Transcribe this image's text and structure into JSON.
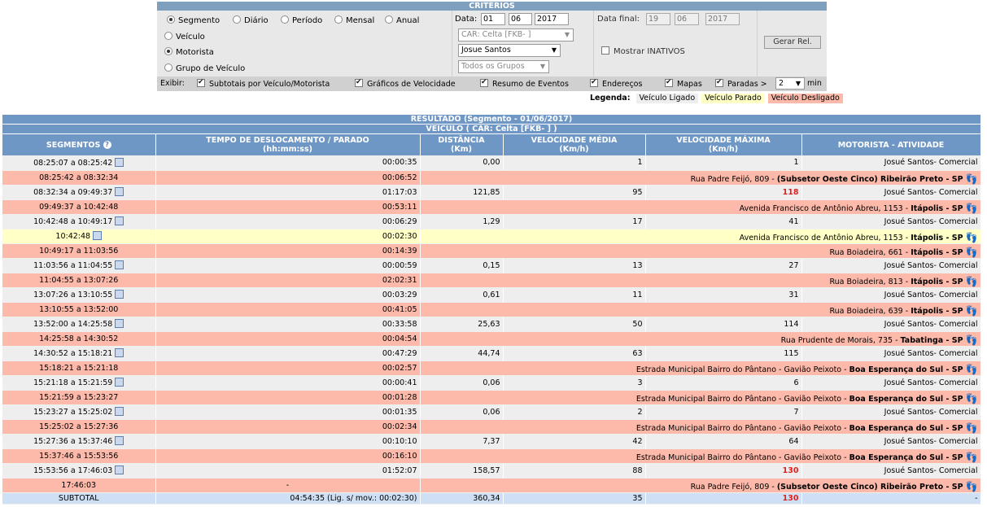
{
  "criteria": {
    "title": "CRITÉRIOS",
    "modes": [
      "Segmento",
      "Diário",
      "Período",
      "Mensal",
      "Anual"
    ],
    "entity_options": [
      "Veículo",
      "Motorista",
      "Grupo de Veículo"
    ],
    "date_label": "Data:",
    "date": {
      "d": "01",
      "m": "06",
      "y": "2017"
    },
    "final_label": "Data final:",
    "final_date": {
      "d": "19",
      "m": "06",
      "y": "2017"
    },
    "vehicle_select": "CAR: Celta [FKB-      ]",
    "driver_select": "Josue Santos",
    "group_select": "Todos os Grupos",
    "show_inactive": "Mostrar INATIVOS",
    "generate_button": "Gerar Rel.",
    "exibir_label": "Exibir:",
    "options": [
      "Subtotais por Veículo/Motorista",
      "Gráficos de Velocidade",
      "Resumo de Eventos",
      "Endereços",
      "Mapas",
      "Paradas >"
    ],
    "paradas_value": "2",
    "min_label": "min"
  },
  "legend": {
    "label": "Legenda:",
    "on": "Veículo Ligado",
    "parked": "Veículo Parado",
    "off": "Veículo Desligado"
  },
  "result": {
    "title": "RESULTADO (Segmento - 01/06/2017)",
    "vehicle": "VEÍCULO ( CAR: Celta [FKB-        ] )",
    "headers": {
      "seg": "SEGMENTOS",
      "time": "TEMPO DE DESLOCAMENTO / PARADO",
      "time_unit": "(hh:mm:ss)",
      "dist": "DISTÂNCIA",
      "dist_unit": "(Km)",
      "avg": "VELOCIDADE MÉDIA",
      "avg_unit": "(Km/h)",
      "max": "VELOCIDADE MÁXIMA",
      "max_unit": "(Km/h)",
      "driver": "MOTORISTA - ATIVIDADE"
    },
    "rows": [
      {
        "t": "on",
        "seg": "08:25:07 a 08:25:42",
        "time": "00:00:35",
        "dist": "0,00",
        "avg": "1",
        "max": "1",
        "drv": "Josué Santos",
        "act": "Comercial"
      },
      {
        "t": "off",
        "seg": "08:25:42 a 08:32:34",
        "time": "00:06:52",
        "addr": "Rua Padre Feijó, 809 - ",
        "city": "(Subsetor Oeste Cinco) Ribeirão Preto - SP"
      },
      {
        "t": "on",
        "seg": "08:32:34 a 09:49:37",
        "time": "01:17:03",
        "dist": "121,85",
        "avg": "95",
        "max": "118",
        "hot": true,
        "drv": "Josué Santos",
        "act": "Comercial"
      },
      {
        "t": "off",
        "seg": "09:49:37 a 10:42:48",
        "time": "00:53:11",
        "addr": "Avenida Francisco de Antônio Abreu, 1153 - ",
        "city": "Itápolis - SP"
      },
      {
        "t": "on",
        "seg": "10:42:48 a 10:49:17",
        "time": "00:06:29",
        "dist": "1,29",
        "avg": "17",
        "max": "41",
        "drv": "Josué Santos",
        "act": "Comercial"
      },
      {
        "t": "park",
        "seg": "10:42:48",
        "time": "00:02:30",
        "addr": "Avenida Francisco de Antônio Abreu, 1153 - ",
        "city": "Itápolis - SP"
      },
      {
        "t": "off",
        "seg": "10:49:17 a 11:03:56",
        "time": "00:14:39",
        "addr": "Rua Boiadeira, 661 - ",
        "city": "Itápolis - SP"
      },
      {
        "t": "on",
        "seg": "11:03:56 a 11:04:55",
        "time": "00:00:59",
        "dist": "0,15",
        "avg": "13",
        "max": "27",
        "drv": "Josué Santos",
        "act": "Comercial"
      },
      {
        "t": "off",
        "seg": "11:04:55 a 13:07:26",
        "time": "02:02:31",
        "addr": "Rua Boiadeira, 813 - ",
        "city": "Itápolis - SP"
      },
      {
        "t": "on",
        "seg": "13:07:26 a 13:10:55",
        "time": "00:03:29",
        "dist": "0,61",
        "avg": "11",
        "max": "31",
        "drv": "Josué Santos",
        "act": "Comercial"
      },
      {
        "t": "off",
        "seg": "13:10:55 a 13:52:00",
        "time": "00:41:05",
        "addr": "Rua Boiadeira, 639 - ",
        "city": "Itápolis - SP"
      },
      {
        "t": "on",
        "seg": "13:52:00 a 14:25:58",
        "time": "00:33:58",
        "dist": "25,63",
        "avg": "50",
        "max": "114",
        "drv": "Josué Santos",
        "act": "Comercial"
      },
      {
        "t": "off",
        "seg": "14:25:58 a 14:30:52",
        "time": "00:04:54",
        "addr": "Rua Prudente de Morais, 735 - ",
        "city": "Tabatinga - SP"
      },
      {
        "t": "on",
        "seg": "14:30:52 a 15:18:21",
        "time": "00:47:29",
        "dist": "44,74",
        "avg": "63",
        "max": "115",
        "drv": "Josué Santos",
        "act": "Comercial"
      },
      {
        "t": "off",
        "seg": "15:18:21 a 15:21:18",
        "time": "00:02:57",
        "addr": "Estrada Municipal Bairro do Pântano - Gavião Peixoto - ",
        "city": "Boa Esperança do Sul - SP"
      },
      {
        "t": "on",
        "seg": "15:21:18 a 15:21:59",
        "time": "00:00:41",
        "dist": "0,06",
        "avg": "3",
        "max": "6",
        "drv": "Josué Santos",
        "act": "Comercial"
      },
      {
        "t": "off",
        "seg": "15:21:59 a 15:23:27",
        "time": "00:01:28",
        "addr": "Estrada Municipal Bairro do Pântano - Gavião Peixoto - ",
        "city": "Boa Esperança do Sul - SP"
      },
      {
        "t": "on",
        "seg": "15:23:27 a 15:25:02",
        "time": "00:01:35",
        "dist": "0,06",
        "avg": "2",
        "max": "7",
        "drv": "Josué Santos",
        "act": "Comercial"
      },
      {
        "t": "off",
        "seg": "15:25:02 a 15:27:36",
        "time": "00:02:34",
        "addr": "Estrada Municipal Bairro do Pântano - Gavião Peixoto - ",
        "city": "Boa Esperança do Sul - SP"
      },
      {
        "t": "on",
        "seg": "15:27:36 a 15:37:46",
        "time": "00:10:10",
        "dist": "7,37",
        "avg": "42",
        "max": "64",
        "drv": "Josué Santos",
        "act": "Comercial"
      },
      {
        "t": "off",
        "seg": "15:37:46 a 15:53:56",
        "time": "00:16:10",
        "addr": "Estrada Municipal Bairro do Pântano - Gavião Peixoto - ",
        "city": "Boa Esperança do Sul - SP"
      },
      {
        "t": "on",
        "seg": "15:53:56 a 17:46:03",
        "time": "01:52:07",
        "dist": "158,57",
        "avg": "88",
        "max": "130",
        "hot": true,
        "drv": "Josué Santos",
        "act": "Comercial"
      },
      {
        "t": "off",
        "seg": "17:46:03",
        "time": "-",
        "center": true,
        "addr": "Rua Padre Feijó, 809 - ",
        "city": "(Subsetor Oeste Cinco) Ribeirão Preto - SP"
      }
    ],
    "subtotal": {
      "label": "SUBTOTAL",
      "time": "04:54:35 (Lig. s/ mov.: 00:02:30)",
      "dist": "360,34",
      "avg": "35",
      "max": "130",
      "drv": "-"
    }
  }
}
